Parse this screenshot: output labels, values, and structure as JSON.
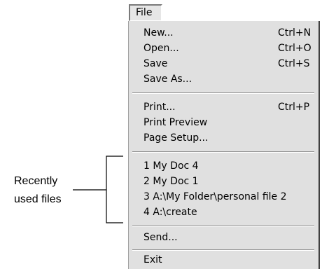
{
  "menu": {
    "title": "File",
    "groups": [
      [
        {
          "label": "New...",
          "shortcut": "Ctrl+N"
        },
        {
          "label": "Open...",
          "shortcut": "Ctrl+O"
        },
        {
          "label": "Save",
          "shortcut": "Ctrl+S"
        },
        {
          "label": "Save As...",
          "shortcut": ""
        }
      ],
      [
        {
          "label": "Print...",
          "shortcut": "Ctrl+P"
        },
        {
          "label": "Print Preview",
          "shortcut": ""
        },
        {
          "label": "Page Setup...",
          "shortcut": ""
        }
      ],
      [
        {
          "label": "1 My Doc 4",
          "shortcut": ""
        },
        {
          "label": "2 My Doc 1",
          "shortcut": ""
        },
        {
          "label": "3 A:\\My Folder\\personal file 2",
          "shortcut": ""
        },
        {
          "label": "4 A:\\create",
          "shortcut": ""
        }
      ],
      [
        {
          "label": "Send...",
          "shortcut": ""
        }
      ],
      [
        {
          "label": "Exit",
          "shortcut": ""
        }
      ]
    ]
  },
  "annotation": {
    "line1": "Recently",
    "line2": "used files"
  }
}
